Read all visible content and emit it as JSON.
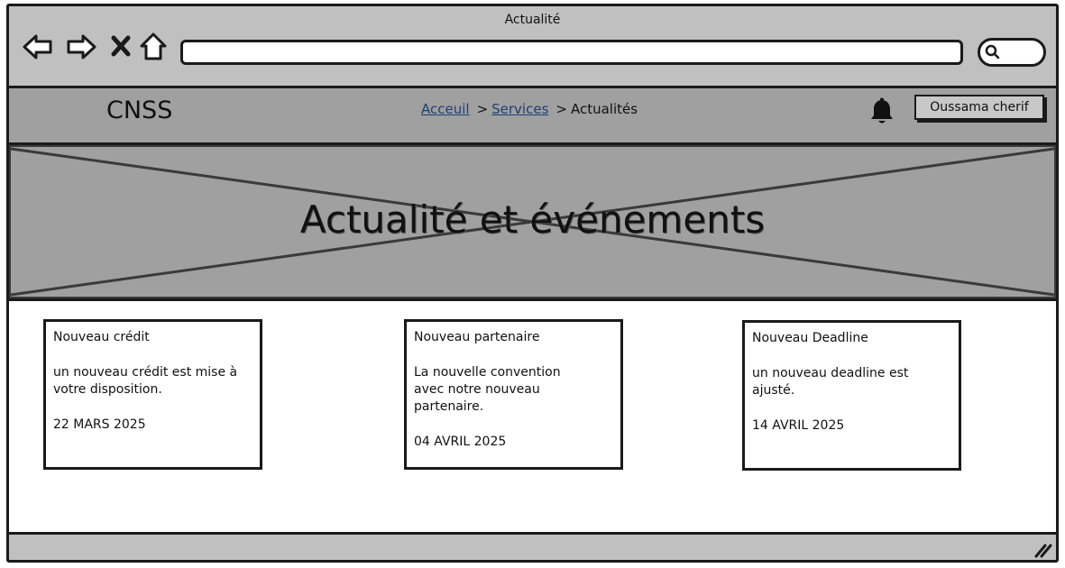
{
  "window": {
    "title": "Actualité",
    "address_value": ""
  },
  "header": {
    "logo": "CNSS",
    "breadcrumb": {
      "home": "Acceuil",
      "services": "Services",
      "current": "Actualités",
      "separator": ">"
    },
    "user_button": "Oussama cherif"
  },
  "hero": {
    "title": "Actualité et événements"
  },
  "cards": [
    {
      "title": "Nouveau crédit",
      "body": "un nouveau crédit est mise à\nvotre disposition.",
      "date": "22 MARS 2025"
    },
    {
      "title": "Nouveau partenaire",
      "body": "La nouvelle convention\navec notre nouveau partenaire.",
      "date": "04 AVRIL 2025"
    },
    {
      "title": "Nouveau Deadline",
      "body": "un nouveau deadline est ajusté.",
      "date": "14 AVRIL 2025"
    }
  ],
  "colors": {
    "chrome": "#c0c0c0",
    "header_bg": "#a0a0a0",
    "link": "#1e3f73",
    "border": "#1a1a1a"
  },
  "icons": [
    "back-icon",
    "forward-icon",
    "stop-icon",
    "home-icon",
    "search-icon",
    "bell-icon",
    "resize-handle-icon"
  ]
}
